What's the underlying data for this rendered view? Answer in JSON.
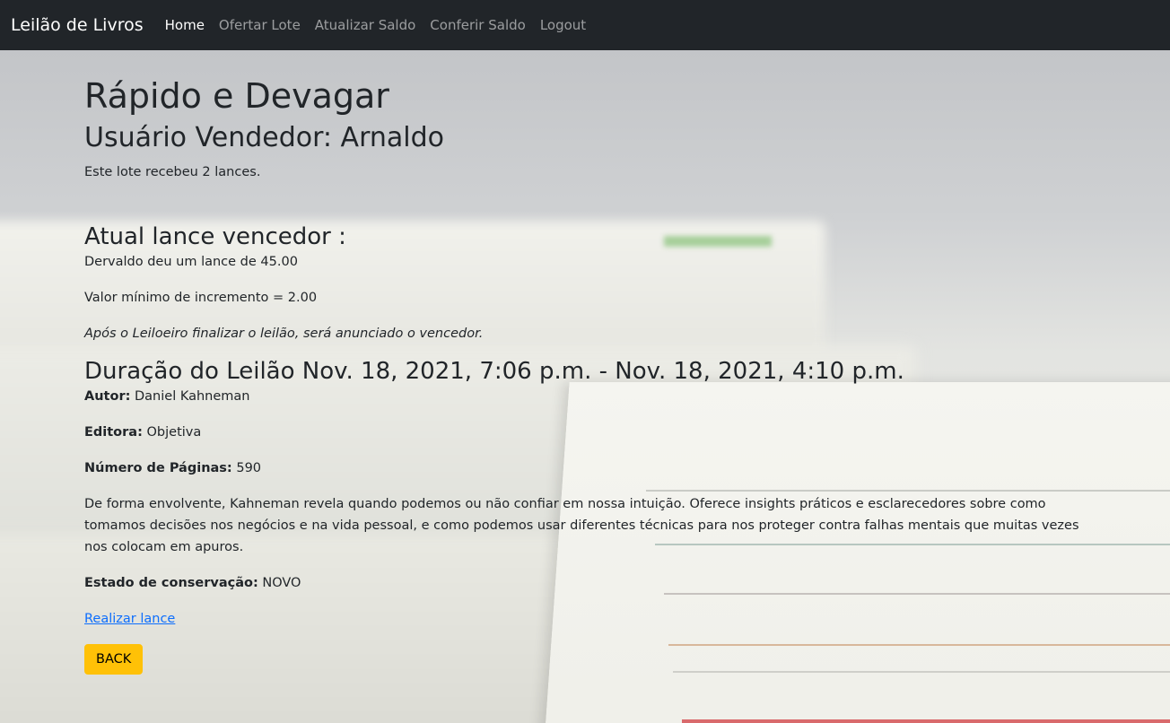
{
  "nav": {
    "brand": "Leilão de Livros",
    "items": [
      "Home",
      "Ofertar Lote",
      "Atualizar Saldo",
      "Conferir Saldo",
      "Logout"
    ]
  },
  "lot": {
    "title": "Rápido e Devagar",
    "seller": "Usuário Vendedor: Arnaldo",
    "bids_text": "Este lote recebeu 2 lances."
  },
  "winner": {
    "heading": "Atual lance vencedor :",
    "bid_text": "Dervaldo deu um lance de 45.00",
    "min_increment": "Valor mínimo de incremento = 2.00",
    "note": "Após o Leiloeiro finalizar o leilão, será anunciado o vencedor."
  },
  "duration": "Duração do Leilão Nov. 18, 2021, 7:06 p.m. - Nov. 18, 2021, 4:10 p.m.",
  "details": {
    "author_label": "Autor:",
    "author": "Daniel Kahneman",
    "publisher_label": "Editora:",
    "publisher": "Objetiva",
    "pages_label": "Número de Páginas:",
    "pages": "590",
    "description": "De forma envolvente, Kahneman revela quando podemos ou não confiar em nossa intuição. Oferece insights práticos e esclarecedores sobre como tomamos decisões nos negócios e na vida pessoal, e como podemos usar diferentes técnicas para nos proteger contra falhas mentais que muitas vezes nos colocam em apuros.",
    "condition_label": "Estado de conservação:",
    "condition": "NOVO"
  },
  "actions": {
    "bid_link": "Realizar lance",
    "back": "BACK"
  },
  "colors": {
    "navbar": "#212529",
    "link": "#0d6efd",
    "back_button": "#ffc107"
  }
}
